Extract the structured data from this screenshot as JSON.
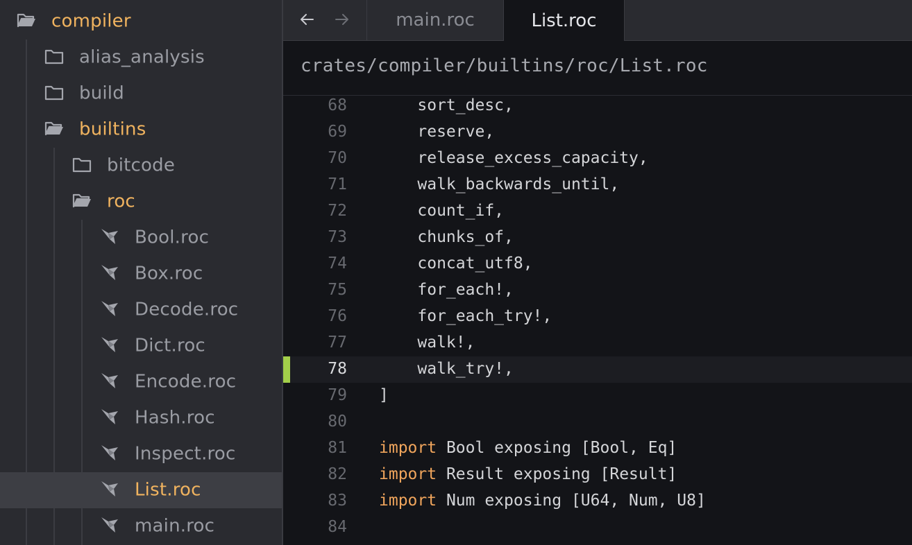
{
  "sidebar": {
    "tree": [
      {
        "label": "compiler",
        "type": "folder-open",
        "depth": 0
      },
      {
        "label": "alias_analysis",
        "type": "folder",
        "depth": 1
      },
      {
        "label": "build",
        "type": "folder",
        "depth": 1
      },
      {
        "label": "builtins",
        "type": "folder-open",
        "depth": 1
      },
      {
        "label": "bitcode",
        "type": "folder",
        "depth": 2
      },
      {
        "label": "roc",
        "type": "folder-open",
        "depth": 2
      },
      {
        "label": "Bool.roc",
        "type": "roc-file",
        "depth": 3
      },
      {
        "label": "Box.roc",
        "type": "roc-file",
        "depth": 3
      },
      {
        "label": "Decode.roc",
        "type": "roc-file",
        "depth": 3
      },
      {
        "label": "Dict.roc",
        "type": "roc-file",
        "depth": 3
      },
      {
        "label": "Encode.roc",
        "type": "roc-file",
        "depth": 3
      },
      {
        "label": "Hash.roc",
        "type": "roc-file",
        "depth": 3
      },
      {
        "label": "Inspect.roc",
        "type": "roc-file",
        "depth": 3
      },
      {
        "label": "List.roc",
        "type": "roc-file",
        "depth": 3,
        "selected": true
      },
      {
        "label": "main.roc",
        "type": "roc-file",
        "depth": 3
      }
    ]
  },
  "tabs": [
    {
      "label": "main.roc",
      "active": false
    },
    {
      "label": "List.roc",
      "active": true
    }
  ],
  "nav": {
    "back_icon": "arrow-left-icon",
    "forward_icon": "arrow-right-icon"
  },
  "breadcrumb": {
    "path": "crates/compiler/builtins/roc/List.roc"
  },
  "editor": {
    "current_line": 78,
    "lines": [
      {
        "n": "68",
        "text": "    sort_desc,"
      },
      {
        "n": "69",
        "text": "    reserve,"
      },
      {
        "n": "70",
        "text": "    release_excess_capacity,"
      },
      {
        "n": "71",
        "text": "    walk_backwards_until,"
      },
      {
        "n": "72",
        "text": "    count_if,"
      },
      {
        "n": "73",
        "text": "    chunks_of,"
      },
      {
        "n": "74",
        "text": "    concat_utf8,"
      },
      {
        "n": "75",
        "text": "    for_each!,"
      },
      {
        "n": "76",
        "text": "    for_each_try!,"
      },
      {
        "n": "77",
        "text": "    walk!,"
      },
      {
        "n": "78",
        "text": "    walk_try!,"
      },
      {
        "n": "79",
        "text": "]"
      },
      {
        "n": "80",
        "text": ""
      },
      {
        "n": "81",
        "kw": "import",
        "text": " Bool exposing [Bool, Eq]"
      },
      {
        "n": "82",
        "kw": "import",
        "text": " Result exposing [Result]"
      },
      {
        "n": "83",
        "kw": "import",
        "text": " Num exposing [U64, Num, U8]"
      },
      {
        "n": "84",
        "text": ""
      }
    ]
  },
  "colors": {
    "folder_open_label": "#f0b35f",
    "keyword": "#f0a55c",
    "git_modified_marker": "#a3cf4a",
    "sidebar_bg": "#2a2b30",
    "editor_bg": "#131418"
  }
}
